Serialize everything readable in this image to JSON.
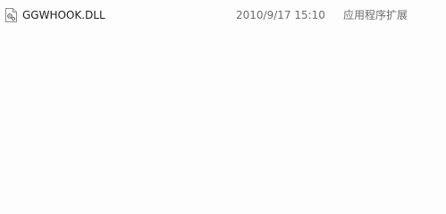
{
  "files": [
    {
      "icon": "dll-file-icon",
      "name": "GGWHOOK.DLL",
      "date_modified": "2010/9/17 15:10",
      "type": "应用程序扩展"
    }
  ],
  "colors": {
    "background": "#fdfdfd",
    "name_text": "#1e1e1e",
    "secondary_text": "#6d6d6d"
  }
}
